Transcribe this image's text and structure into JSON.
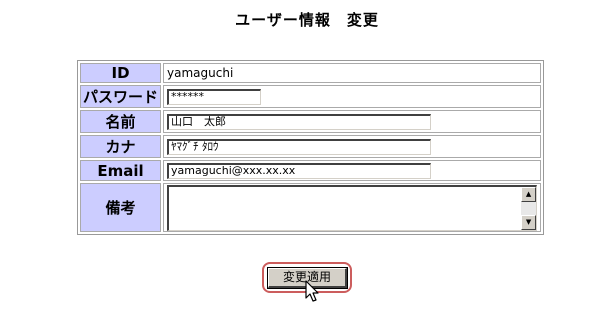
{
  "page": {
    "title": "ユーザー情報　変更"
  },
  "form": {
    "id": {
      "label": "ID",
      "value": "yamaguchi"
    },
    "password": {
      "label": "パスワード",
      "value": "******"
    },
    "name": {
      "label": "名前",
      "value": "山口　太郎"
    },
    "kana": {
      "label": "カナ",
      "value": "ﾔﾏｸﾞﾁ ﾀﾛｳ"
    },
    "email": {
      "label": "Email",
      "value": "yamaguchi@xxx.xx.xx"
    },
    "note": {
      "label": "備考",
      "value": ""
    }
  },
  "actions": {
    "apply_label": "変更適用"
  },
  "icons": {
    "scroll_up": "scroll-up-arrow-icon",
    "scroll_down": "scroll-down-arrow-icon",
    "cursor": "mouse-pointer-icon"
  },
  "colors": {
    "label_background": "#cccdff",
    "button_highlight": "#cc5d5d"
  }
}
